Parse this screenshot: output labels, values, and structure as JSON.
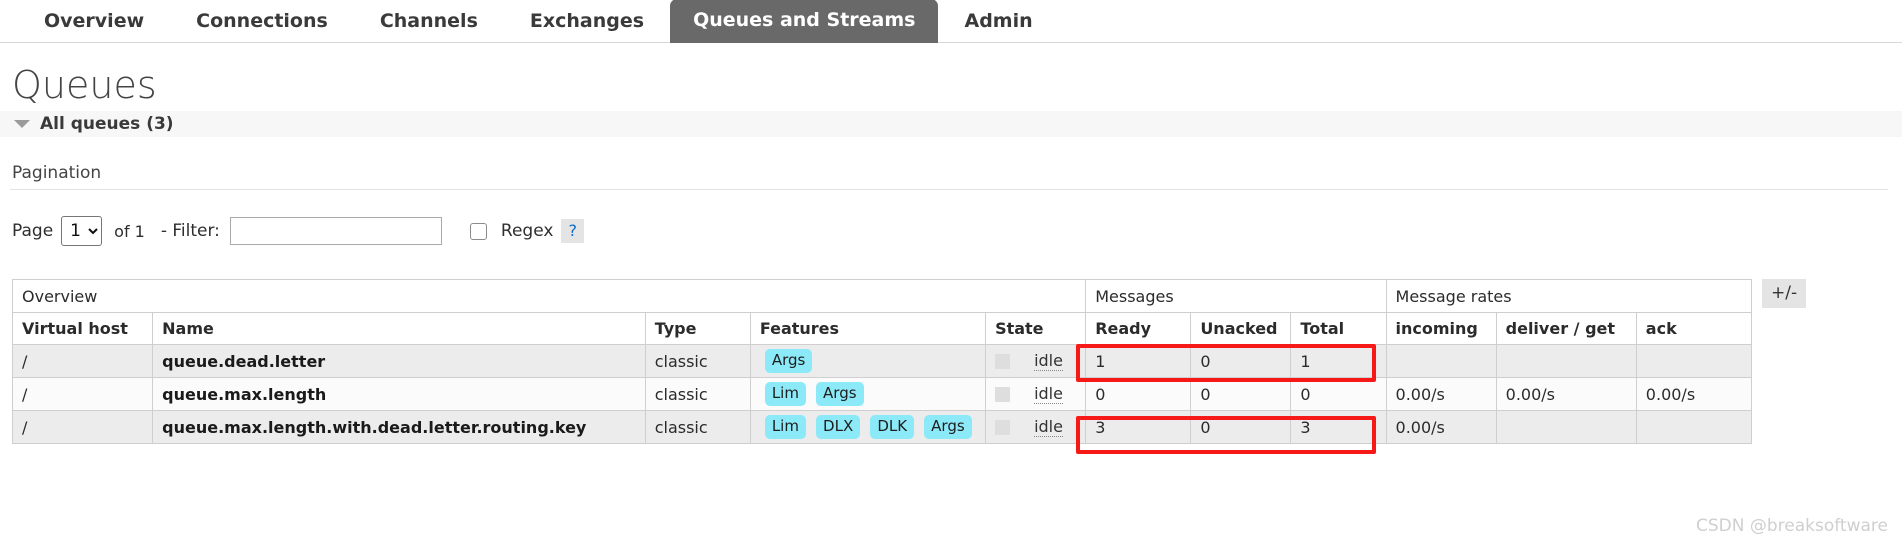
{
  "nav": {
    "items": [
      {
        "label": "Overview",
        "active": false
      },
      {
        "label": "Connections",
        "active": false
      },
      {
        "label": "Channels",
        "active": false
      },
      {
        "label": "Exchanges",
        "active": false
      },
      {
        "label": "Queues and Streams",
        "active": true
      },
      {
        "label": "Admin",
        "active": false
      }
    ]
  },
  "page": {
    "title": "Queues",
    "section_label": "All queues (3)"
  },
  "pagination": {
    "label": "Pagination",
    "page_word": "Page",
    "page_value": "1",
    "page_options": [
      "1"
    ],
    "of_text": "of 1",
    "filter_word": "- Filter:",
    "filter_value": "",
    "filter_placeholder": "",
    "regex_label": "Regex",
    "regex_checked": false,
    "help_marker": "?"
  },
  "table": {
    "group_headers": [
      {
        "label": "Overview",
        "span": 5
      },
      {
        "label": "Messages",
        "span": 3
      },
      {
        "label": "Message rates",
        "span": 3
      }
    ],
    "columns": [
      {
        "key": "vhost",
        "label": "Virtual host",
        "bold": true,
        "align": "left"
      },
      {
        "key": "name",
        "label": "Name",
        "bold": true,
        "align": "left"
      },
      {
        "key": "type",
        "label": "Type",
        "bold": true,
        "align": "left"
      },
      {
        "key": "features",
        "label": "Features",
        "bold": false,
        "align": "left"
      },
      {
        "key": "state",
        "label": "State",
        "bold": true,
        "align": "left"
      },
      {
        "key": "ready",
        "label": "Ready",
        "bold": true,
        "align": "left"
      },
      {
        "key": "unacked",
        "label": "Unacked",
        "bold": true,
        "align": "left"
      },
      {
        "key": "total",
        "label": "Total",
        "bold": true,
        "align": "left"
      },
      {
        "key": "incoming",
        "label": "incoming",
        "bold": true,
        "align": "left"
      },
      {
        "key": "deliver_get",
        "label": "deliver / get",
        "bold": true,
        "align": "left"
      },
      {
        "key": "ack",
        "label": "ack",
        "bold": true,
        "align": "left"
      }
    ],
    "toggle_columns_label": "+/-",
    "rows": [
      {
        "vhost": "/",
        "name": "queue.dead.letter",
        "type": "classic",
        "features": [
          "Args"
        ],
        "state": "idle",
        "ready": "1",
        "unacked": "0",
        "total": "1",
        "incoming": "",
        "deliver_get": "",
        "ack": "",
        "highlighted": true
      },
      {
        "vhost": "/",
        "name": "queue.max.length",
        "type": "classic",
        "features": [
          "Lim",
          "Args"
        ],
        "state": "idle",
        "ready": "0",
        "unacked": "0",
        "total": "0",
        "incoming": "0.00/s",
        "deliver_get": "0.00/s",
        "ack": "0.00/s",
        "highlighted": false
      },
      {
        "vhost": "/",
        "name": "queue.max.length.with.dead.letter.routing.key",
        "type": "classic",
        "features": [
          "Lim",
          "DLX",
          "DLK",
          "Args"
        ],
        "state": "idle",
        "ready": "3",
        "unacked": "0",
        "total": "3",
        "incoming": "0.00/s",
        "deliver_get": "",
        "ack": "",
        "highlighted": true
      }
    ]
  },
  "colors": {
    "active_tab_bg": "#696969",
    "badge_bg": "#8ce9f7",
    "annotation": "#f71818",
    "row_odd": "#ececec",
    "row_even": "#fbfbfb"
  },
  "watermark": "CSDN @breaksoftware"
}
